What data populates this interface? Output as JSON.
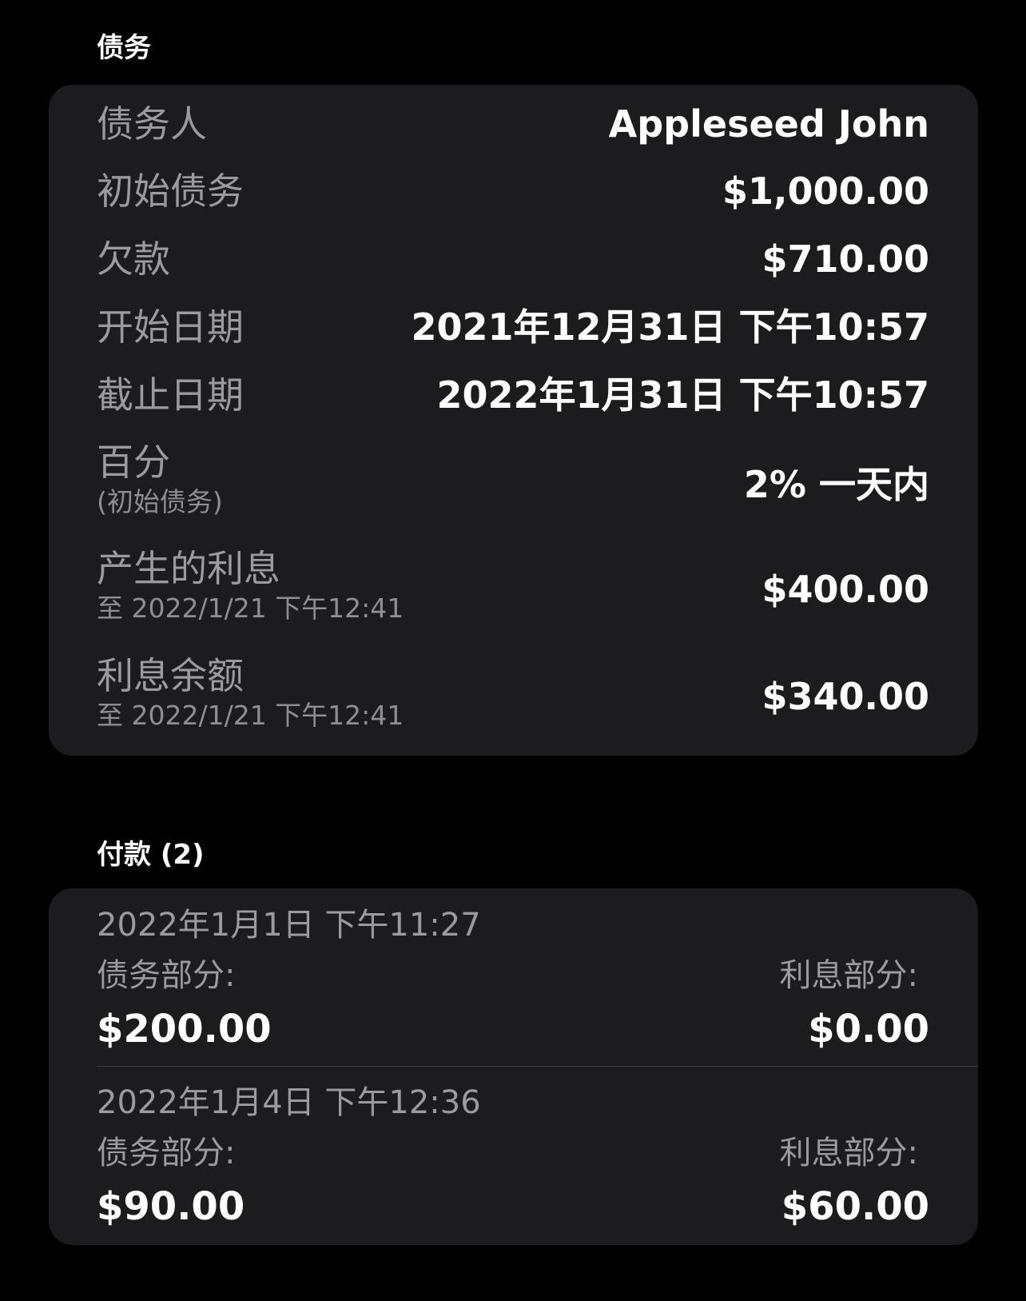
{
  "debt_section": {
    "header": "债务",
    "rows": [
      {
        "label": "债务人",
        "value": "Appleseed John"
      },
      {
        "label": "初始债务",
        "value": "$1,000.00"
      },
      {
        "label": "欠款",
        "value": "$710.00"
      },
      {
        "label": "开始日期",
        "value": "2021年12月31日 下午10:57"
      },
      {
        "label": "截止日期",
        "value": "2022年1月31日 下午10:57"
      },
      {
        "label": "百分",
        "sublabel": "(初始债务)",
        "value": "2% 一天内"
      },
      {
        "label": "产生的利息",
        "sublabel": "至 2022/1/21 下午12:41",
        "value": "$400.00"
      },
      {
        "label": "利息余额",
        "sublabel": "至 2022/1/21 下午12:41",
        "value": "$340.00"
      }
    ]
  },
  "payments_section": {
    "header": "付款 (2)",
    "payments": [
      {
        "date": "2022年1月1日 下午11:27",
        "debt_part_label": "债务部分:",
        "debt_part_value": "$200.00",
        "interest_part_label": "利息部分:",
        "interest_part_value": "$0.00"
      },
      {
        "date": "2022年1月4日 下午12:36",
        "debt_part_label": "债务部分:",
        "debt_part_value": "$90.00",
        "interest_part_label": "利息部分:",
        "interest_part_value": "$60.00"
      }
    ]
  },
  "colors": {
    "background": "#000000",
    "card": "#1c1c1e",
    "label": "#9a9a9f",
    "value": "#ffffff",
    "divider": "#3a3a3c"
  }
}
